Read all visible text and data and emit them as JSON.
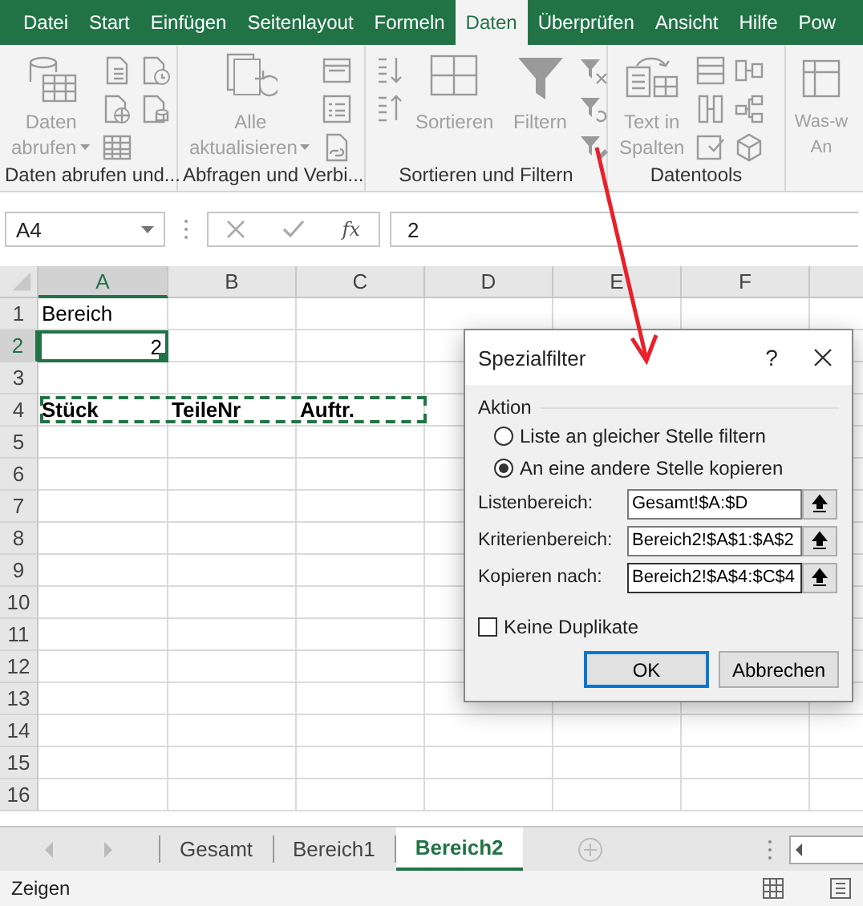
{
  "ribbon_tabs": [
    {
      "label": "Datei",
      "selected": false
    },
    {
      "label": "Start",
      "selected": false
    },
    {
      "label": "Einfügen",
      "selected": false
    },
    {
      "label": "Seitenlayout",
      "selected": false
    },
    {
      "label": "Formeln",
      "selected": false
    },
    {
      "label": "Daten",
      "selected": true
    },
    {
      "label": "Überprüfen",
      "selected": false
    },
    {
      "label": "Ansicht",
      "selected": false
    },
    {
      "label": "Hilfe",
      "selected": false
    },
    {
      "label": "Pow",
      "selected": false
    }
  ],
  "ribbon_groups": [
    {
      "label": "Daten abrufen und...",
      "buttons": [
        {
          "lines": [
            "Daten",
            "abrufen"
          ],
          "dropdown": true,
          "disabled": true
        }
      ]
    },
    {
      "label": "Abfragen und Verbi...",
      "buttons": [
        {
          "lines": [
            "Alle",
            "aktualisieren"
          ],
          "dropdown": true,
          "disabled": true
        }
      ]
    },
    {
      "label": "Sortieren und Filtern",
      "buttons": [
        {
          "lines": [
            "Sortieren"
          ],
          "dropdown": false,
          "disabled": true
        },
        {
          "lines": [
            "Filtern"
          ],
          "dropdown": false,
          "disabled": true
        }
      ]
    },
    {
      "label": "Datentools",
      "buttons": [
        {
          "lines": [
            "Text in",
            "Spalten"
          ],
          "dropdown": false,
          "disabled": true
        }
      ]
    },
    {
      "buttons": [
        {
          "lines": [
            "Was-w",
            "An"
          ],
          "dropdown": false,
          "disabled": true
        }
      ]
    }
  ],
  "formula_bar": {
    "name_box": "A4",
    "function_label": "fx",
    "formula": "2"
  },
  "sheet": {
    "columns": [
      {
        "label": "A",
        "selected": true
      },
      {
        "label": "B",
        "selected": false
      },
      {
        "label": "C",
        "selected": false
      },
      {
        "label": "D",
        "selected": false
      },
      {
        "label": "E",
        "selected": false
      },
      {
        "label": "F",
        "selected": false
      }
    ],
    "rows": [
      {
        "header": "1",
        "selected": false,
        "copy_marquee": false,
        "cells": [
          {
            "text": "Bereich",
            "kind": "text",
            "bold": false,
            "selected": false
          }
        ]
      },
      {
        "header": "2",
        "selected": true,
        "copy_marquee": false,
        "cells": [
          {
            "text": "2",
            "kind": "number",
            "bold": false,
            "selected": true
          }
        ]
      },
      {
        "header": "3",
        "selected": false,
        "copy_marquee": false,
        "cells": []
      },
      {
        "header": "4",
        "selected": false,
        "copy_marquee": true,
        "cells": [
          {
            "text": "Stück",
            "kind": "text",
            "bold": true,
            "selected": false
          },
          {
            "text": "TeileNr",
            "kind": "text",
            "bold": true,
            "selected": false
          },
          {
            "text": "Auftr.",
            "kind": "text",
            "bold": true,
            "selected": false
          }
        ]
      },
      {
        "header": "5",
        "selected": false,
        "copy_marquee": false,
        "cells": []
      },
      {
        "header": "6",
        "selected": false,
        "copy_marquee": false,
        "cells": []
      },
      {
        "header": "7",
        "selected": false,
        "copy_marquee": false,
        "cells": []
      },
      {
        "header": "8",
        "selected": false,
        "copy_marquee": false,
        "cells": []
      },
      {
        "header": "9",
        "selected": false,
        "copy_marquee": false,
        "cells": []
      },
      {
        "header": "10",
        "selected": false,
        "copy_marquee": false,
        "cells": []
      },
      {
        "header": "11",
        "selected": false,
        "copy_marquee": false,
        "cells": []
      },
      {
        "header": "12",
        "selected": false,
        "copy_marquee": false,
        "cells": []
      },
      {
        "header": "13",
        "selected": false,
        "copy_marquee": false,
        "cells": []
      },
      {
        "header": "14",
        "selected": false,
        "copy_marquee": false,
        "cells": []
      },
      {
        "header": "15",
        "selected": false,
        "copy_marquee": false,
        "cells": []
      },
      {
        "header": "16",
        "selected": false,
        "copy_marquee": false,
        "cells": []
      }
    ]
  },
  "sheet_tabs": [
    {
      "label": "Gesamt",
      "selected": false
    },
    {
      "label": "Bereich1",
      "selected": false
    },
    {
      "label": "Bereich2",
      "selected": true
    }
  ],
  "status_bar": {
    "text": "Zeigen"
  },
  "dialog": {
    "title": "Spezialfilter",
    "help": "?",
    "section": "Aktion",
    "options": [
      {
        "label": "Liste an gleicher Stelle filtern",
        "selected": false
      },
      {
        "label": "An eine andere Stelle kopieren",
        "selected": true
      }
    ],
    "fields": [
      {
        "label": "Listenbereich:",
        "value": "Gesamt!$A:$D",
        "focused": false
      },
      {
        "label": "Kriterienbereich:",
        "value": "Bereich2!$A$1:$A$2",
        "focused": false
      },
      {
        "label": "Kopieren nach:",
        "value": "Bereich2!$A$4:$C$4",
        "focused": true
      }
    ],
    "checkbox": {
      "label": "Keine Duplikate",
      "checked": false
    },
    "buttons": [
      {
        "label": "OK",
        "default": true
      },
      {
        "label": "Abbrechen",
        "default": false
      }
    ]
  }
}
